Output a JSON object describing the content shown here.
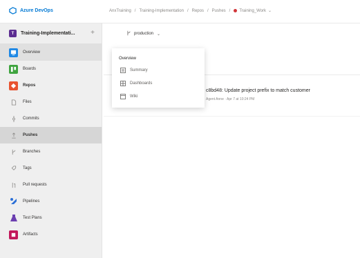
{
  "topbar": {
    "brand": "Azure DevOps",
    "breadcrumbs": [
      "AnxTraining",
      "Training-Implementation",
      "Repos",
      "Pushes",
      "Training_Work"
    ]
  },
  "sidebar": {
    "project_initial": "T",
    "project_name": "Training-Implementati...",
    "items": [
      {
        "label": "Overview",
        "icon": "overview-icon",
        "kind": "main",
        "color": "#1e88e5"
      },
      {
        "label": "Boards",
        "icon": "boards-icon",
        "kind": "main",
        "color": "#3fa43f"
      },
      {
        "label": "Repos",
        "icon": "repos-icon",
        "kind": "main",
        "color": "#e8532f"
      },
      {
        "label": "Files",
        "icon": "file-icon",
        "kind": "sub"
      },
      {
        "label": "Commits",
        "icon": "commit-icon",
        "kind": "sub"
      },
      {
        "label": "Pushes",
        "icon": "push-icon",
        "kind": "sub"
      },
      {
        "label": "Branches",
        "icon": "branch-icon",
        "kind": "sub"
      },
      {
        "label": "Tags",
        "icon": "tag-icon",
        "kind": "sub"
      },
      {
        "label": "Pull requests",
        "icon": "pull-request-icon",
        "kind": "sub"
      },
      {
        "label": "Pipelines",
        "icon": "pipelines-icon",
        "kind": "main",
        "color": "#2b6fd6"
      },
      {
        "label": "Test Plans",
        "icon": "test-plans-icon",
        "kind": "main",
        "color": "#6b3fb0"
      },
      {
        "label": "Artifacts",
        "icon": "artifacts-icon",
        "kind": "main",
        "color": "#c2185b"
      }
    ]
  },
  "main": {
    "branch": "production",
    "commit_title": "c8bd48: Update project prefix to match customer",
    "commit_meta": "Agent Anne · Apr 7 at 10:24 PM"
  },
  "dropdown": {
    "header": "Overview",
    "items": [
      {
        "label": "Summary",
        "icon": "summary-icon"
      },
      {
        "label": "Dashboards",
        "icon": "dashboards-icon"
      },
      {
        "label": "Wiki",
        "icon": "wiki-icon"
      }
    ]
  },
  "colors": {
    "accent": "#0078d4",
    "active_nav_bg": "#d6d6d6"
  }
}
